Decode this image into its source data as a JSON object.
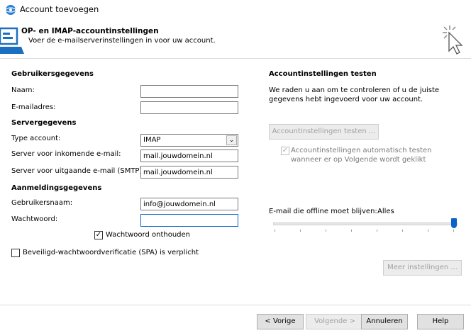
{
  "window": {
    "title": "Account toevoegen"
  },
  "header": {
    "title": "OP- en IMAP-accountinstellingen",
    "subtitle": "Voer de e-mailserverinstellingen in voor uw account."
  },
  "user_info": {
    "section": "Gebruikersgegevens",
    "name_label": "Naam:",
    "name_value": "",
    "email_label": "E-mailadres:",
    "email_value": ""
  },
  "server_info": {
    "section": "Servergegevens",
    "account_type_label": "Type account:",
    "account_type_value": "IMAP",
    "incoming_label": "Server voor inkomende e-mail:",
    "incoming_value": "mail.jouwdomein.nl",
    "outgoing_label": "Server voor uitgaande e-mail (SMTP):",
    "outgoing_value": "mail.jouwdomein.nl"
  },
  "login_info": {
    "section": "Aanmeldingsgegevens",
    "username_label": "Gebruikersnaam:",
    "username_value": "info@jouwdomein.nl",
    "password_label": "Wachtwoord:",
    "password_value": "",
    "remember_label": "Wachtwoord onthouden",
    "remember_checked": true,
    "spa_label": "Beveiligd-wachtwoordverificatie (SPA) is verplicht",
    "spa_checked": false
  },
  "test": {
    "section": "Accountinstellingen testen",
    "description": "We raden u aan om te controleren of u de juiste gegevens hebt ingevoerd voor uw account.",
    "test_button": "Accountinstellingen testen ...",
    "auto_test_label": "Accountinstellingen automatisch testen wanneer er op Volgende wordt geklikt",
    "auto_test_checked": true
  },
  "offline": {
    "label": "E-mail die offline moet blijven:",
    "value": "Alles",
    "slider_level": 1.0
  },
  "more_settings_button": "Meer instellingen ...",
  "footer": {
    "back": "< Vorige",
    "next": "Volgende >",
    "cancel": "Annuleren",
    "help": "Help"
  },
  "colors": {
    "accent": "#0a64c8",
    "button_bg": "#e1e1e1",
    "disabled_text": "#a0a0a0"
  }
}
